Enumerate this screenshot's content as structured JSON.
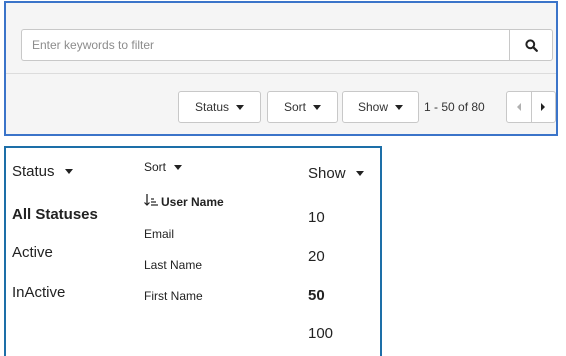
{
  "filter_bar": {
    "search_placeholder": "Enter keywords to filter",
    "search_icon": "search-icon"
  },
  "toolbar": {
    "status_label": "Status",
    "sort_label": "Sort",
    "show_label": "Show",
    "range_text": "1 - 50 of 80",
    "prev_icon": "chevron-left-icon",
    "next_icon": "chevron-right-icon"
  },
  "menus": {
    "status": {
      "label": "Status",
      "options": [
        "All Statuses",
        "Active",
        "InActive"
      ],
      "selected": "All Statuses"
    },
    "sort": {
      "label": "Sort",
      "options": [
        "User Name",
        "Email",
        "Last Name",
        "First Name"
      ],
      "selected": "User Name",
      "selected_icon": "sort-ascending-icon"
    },
    "show": {
      "label": "Show",
      "options": [
        "10",
        "20",
        "50",
        "100"
      ],
      "selected": "50"
    }
  },
  "colors": {
    "top_panel_border": "#3b74c9",
    "bottom_panel_border": "#1d6fa8",
    "band_background": "#f5f5f5"
  }
}
